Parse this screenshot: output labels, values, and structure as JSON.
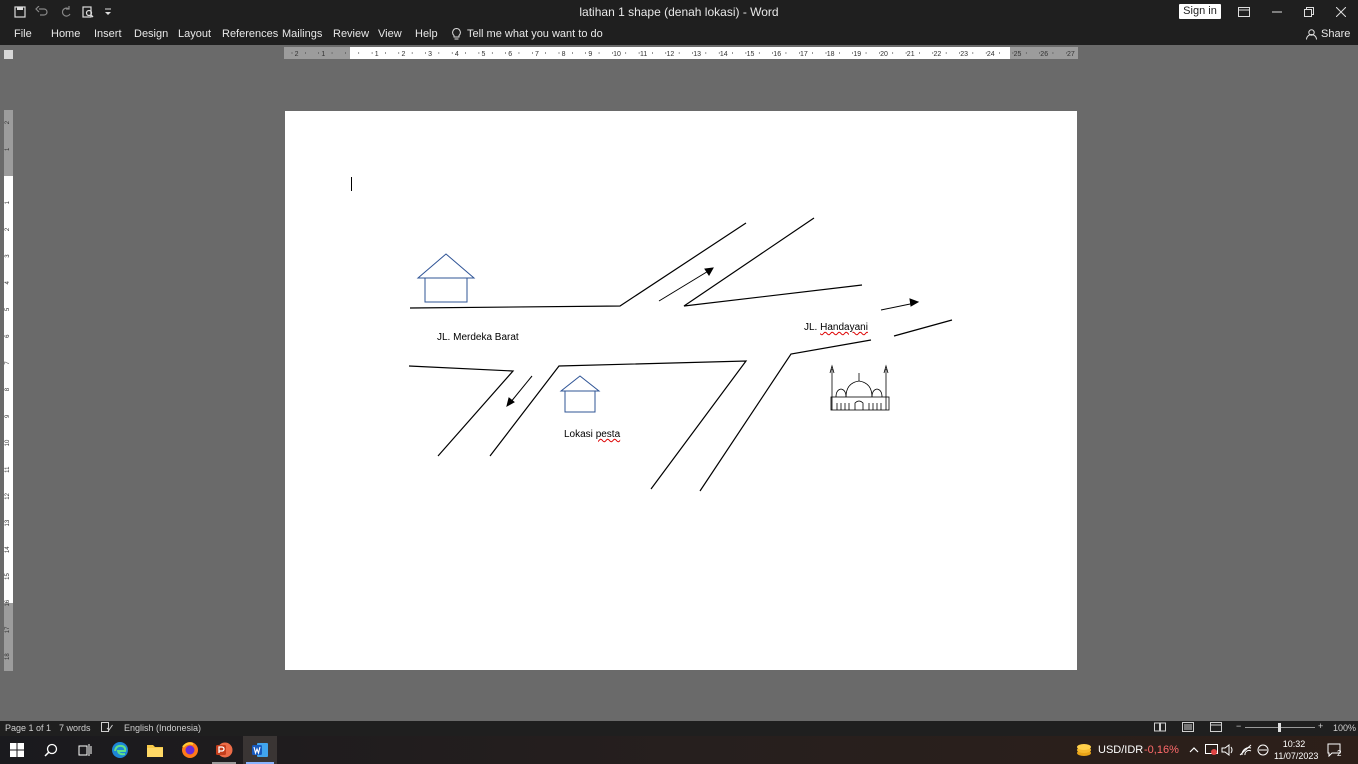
{
  "window": {
    "title": "latihan 1 shape (denah lokasi)  -  Word",
    "sign_in": "Sign in"
  },
  "ribbon": {
    "tabs": [
      "File",
      "Home",
      "Insert",
      "Design",
      "Layout",
      "References",
      "Mailings",
      "Review",
      "View",
      "Help"
    ],
    "tell_me": "Tell me what you want to do",
    "share": "Share"
  },
  "ruler": {
    "horizontal_labels": [
      "2",
      "1",
      "1",
      "2",
      "3",
      "4",
      "5",
      "6",
      "7",
      "8",
      "9",
      "10",
      "11",
      "12",
      "13",
      "14",
      "15",
      "16",
      "17",
      "18",
      "19",
      "20",
      "21",
      "22",
      "23",
      "24",
      "25",
      "26",
      "27"
    ],
    "vertical_labels": [
      "2",
      "1",
      "1",
      "2",
      "3",
      "4",
      "5",
      "6",
      "7",
      "8",
      "9",
      "10",
      "11",
      "12",
      "13",
      "14",
      "15",
      "16",
      "17",
      "18"
    ]
  },
  "document": {
    "labels": {
      "merdeka": "JL. Merdeka Barat",
      "handayani_prefix": "JL. ",
      "handayani": "Handayani",
      "lokasi": "Lokasi ",
      "pesta": "pesta"
    },
    "icons": [
      "house-icon",
      "house-icon",
      "mosque-icon",
      "arrow-icon"
    ]
  },
  "status": {
    "page": "Page 1 of 1",
    "words": "7 words",
    "language": "English (Indonesia)",
    "zoom": "100%"
  },
  "taskbar": {
    "apps": [
      "windows-start-icon",
      "search-icon",
      "task-view-icon",
      "edge-icon",
      "file-explorer-icon",
      "firefox-icon",
      "powerpoint-icon",
      "word-icon"
    ],
    "ticker_label": "USD/IDR",
    "ticker_change": "-0,16%",
    "time": "10:32",
    "date": "11/07/2023",
    "notifications": "2"
  },
  "colors": {
    "chrome": "#1f1f1f",
    "canvas": "#6a6a6a",
    "house_stroke": "#2f5496",
    "negative": "#ff6a6a"
  }
}
